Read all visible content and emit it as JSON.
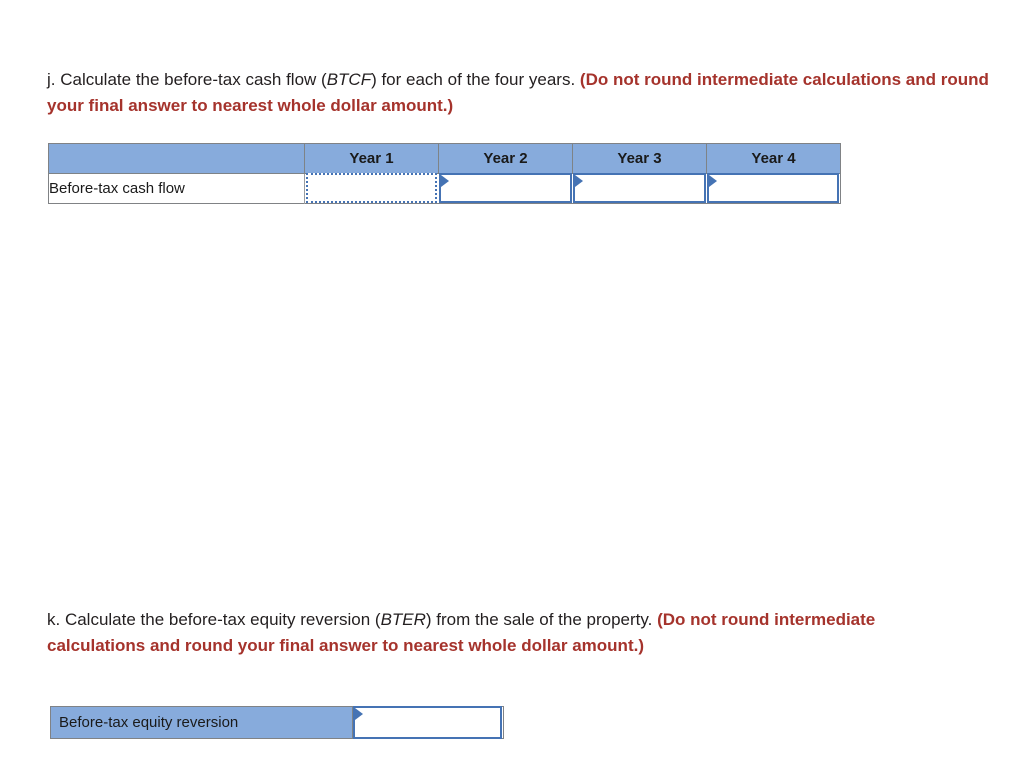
{
  "questions": {
    "j": {
      "lead": "j. Calculate the before-tax cash flow (",
      "abbr": "BTCF",
      "mid": ") for each of the four years. ",
      "instruction": "(Do not round intermediate calculations and round your final answer to nearest whole dollar amount.)"
    },
    "k": {
      "lead": "k. Calculate the before-tax equity reversion (",
      "abbr": "BTER",
      "mid": ") from the sale of the property. ",
      "instruction": "(Do not round intermediate calculations and round your final answer to nearest whole dollar amount.)"
    }
  },
  "btcf_table": {
    "corner_header": "",
    "column_headers": [
      "Year 1",
      "Year 2",
      "Year 3",
      "Year 4"
    ],
    "row_label": "Before-tax cash flow",
    "values": [
      "",
      "",
      "",
      ""
    ],
    "placeholders": [
      "",
      "",
      "",
      ""
    ],
    "focused_index": 0
  },
  "bter_table": {
    "row_label": "Before-tax equity reversion",
    "value": "",
    "placeholder": ""
  },
  "colors": {
    "header_blue": "#87ABDC",
    "input_border_blue": "#4573B4",
    "table_border_gray": "#808285",
    "instruction_red": "#a5332c",
    "body_text": "#231f20"
  }
}
